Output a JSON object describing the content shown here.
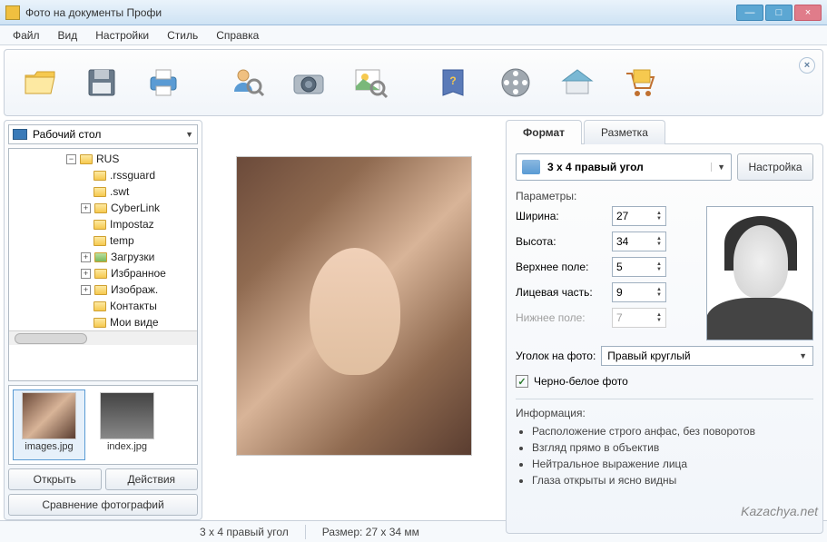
{
  "window": {
    "title": "Фото на документы Профи"
  },
  "menu": {
    "file": "Файл",
    "view": "Вид",
    "settings": "Настройки",
    "style": "Стиль",
    "help": "Справка"
  },
  "location": {
    "label": "Рабочий стол"
  },
  "tree": {
    "rus": "RUS",
    "rssguard": ".rssguard",
    "swt": ".swt",
    "cyberlink": "CyberLink",
    "impostaz": "Impostaz",
    "temp": "temp",
    "downloads": "Загрузки",
    "favourites": "Избранное",
    "images": "Изображ.",
    "contacts": "Контакты",
    "videos": "Мои виде"
  },
  "thumbs": {
    "images": "images.jpg",
    "index": "index.jpg"
  },
  "buttons": {
    "open": "Открыть",
    "actions": "Действия",
    "compare": "Сравнение фотографий",
    "configure": "Настройка"
  },
  "tabs": {
    "format": "Формат",
    "layout": "Разметка"
  },
  "format": {
    "name": "3 x 4 правый угол",
    "params_title": "Параметры:",
    "width_label": "Ширина:",
    "height_label": "Высота:",
    "top_label": "Верхнее поле:",
    "face_label": "Лицевая часть:",
    "bottom_label": "Нижнее поле:",
    "width": "27",
    "height": "34",
    "top": "5",
    "face": "9",
    "bottom": "7",
    "corner_label": "Уголок на фото:",
    "corner_value": "Правый круглый",
    "bw_label": "Черно-белое фото"
  },
  "info": {
    "title": "Информация:",
    "l1": "Расположение строго анфас, без поворотов",
    "l2": "Взгляд прямо в объектив",
    "l3": "Нейтральное выражение лица",
    "l4": "Глаза открыты и ясно видны"
  },
  "status": {
    "format": "3 x 4 правый угол",
    "size": "Размер: 27 x 34 мм"
  },
  "watermark": "Kazachya.net"
}
